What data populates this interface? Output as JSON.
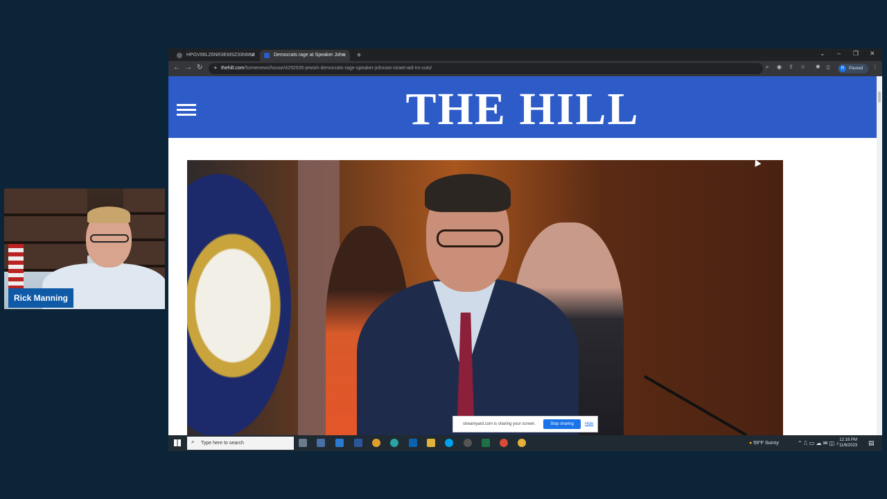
{
  "webcam": {
    "name": "Rick Manning"
  },
  "browser": {
    "tabs": [
      {
        "label": "HPGV66LZ6NR3EMSZ33NMUI",
        "active": false
      },
      {
        "label": "Democrats rage at Speaker John",
        "active": true
      }
    ],
    "url_host": "thehill.com",
    "url_path": "/homenews/house/4292935-jewish-democrats-rage-speaker-johnson-israel-aid-irs-cuts/",
    "profile_initial": "R",
    "profile_status": "Paused",
    "window_controls": {
      "collapse": "⌄",
      "minimize": "–",
      "restore": "❐",
      "close": "✕"
    },
    "nav": {
      "back": "←",
      "forward": "→",
      "reload": "↻"
    },
    "new_tab": "+"
  },
  "site": {
    "logo": "THE HILL",
    "brand_color": "#2d5bc8"
  },
  "share_banner": {
    "message": "streamyard.com is sharing your screen.",
    "stop_label": "Stop sharing",
    "hide_label": "Hide"
  },
  "taskbar": {
    "search_placeholder": "Type here to search",
    "weather": "59°F  Sunny",
    "time": "12:16 PM",
    "date": "11/6/2023"
  }
}
